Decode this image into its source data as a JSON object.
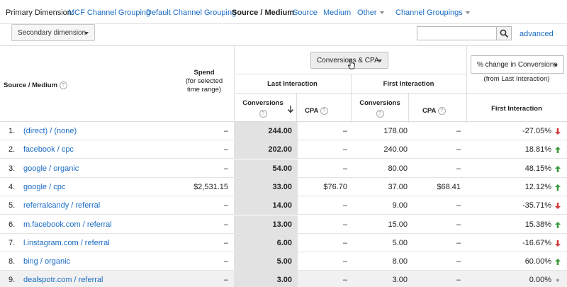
{
  "dimension_bar": {
    "primary_label": "Primary Dimension:",
    "items": [
      {
        "label": "MCF Channel Grouping",
        "active": false
      },
      {
        "label": "Default Channel Grouping",
        "active": false
      },
      {
        "label": "Source / Medium",
        "active": true
      },
      {
        "label": "Source",
        "active": false
      },
      {
        "label": "Medium",
        "active": false
      }
    ],
    "other_label": "Other",
    "channel_groupings_label": "Channel Groupings"
  },
  "toolbar": {
    "secondary_dimension_label": "Secondary dimension",
    "search_value": "",
    "advanced_label": "advanced"
  },
  "header": {
    "source_medium": "Source / Medium",
    "spend_line1": "Spend",
    "spend_line2": "(for selected",
    "spend_line3": "time range)",
    "metric_selector": "Conversions & CPA",
    "last_interaction": "Last Interaction",
    "first_interaction": "First Interaction",
    "conversions": "Conversions",
    "cpa": "CPA",
    "pct_selector": "% change in Conversions",
    "from_last": "(from Last Interaction)",
    "first_interaction_sub": "First Interaction"
  },
  "rows": [
    {
      "index": "1.",
      "source": "(direct) / (none)",
      "spend": "–",
      "last_conv": "244.00",
      "last_cpa": "–",
      "first_conv": "178.00",
      "first_cpa": "–",
      "pct": "-27.05%",
      "trend": "down"
    },
    {
      "index": "2.",
      "source": "facebook / cpc",
      "spend": "–",
      "last_conv": "202.00",
      "last_cpa": "–",
      "first_conv": "240.00",
      "first_cpa": "–",
      "pct": "18.81%",
      "trend": "up"
    },
    {
      "index": "3.",
      "source": "google / organic",
      "spend": "–",
      "last_conv": "54.00",
      "last_cpa": "–",
      "first_conv": "80.00",
      "first_cpa": "–",
      "pct": "48.15%",
      "trend": "up"
    },
    {
      "index": "4.",
      "source": "google / cpc",
      "spend": "$2,531.15",
      "last_conv": "33.00",
      "last_cpa": "$76.70",
      "first_conv": "37.00",
      "first_cpa": "$68.41",
      "pct": "12.12%",
      "trend": "up"
    },
    {
      "index": "5.",
      "source": "referralcandy / referral",
      "spend": "–",
      "last_conv": "14.00",
      "last_cpa": "–",
      "first_conv": "9.00",
      "first_cpa": "–",
      "pct": "-35.71%",
      "trend": "down"
    },
    {
      "index": "6.",
      "source": "m.facebook.com / referral",
      "spend": "–",
      "last_conv": "13.00",
      "last_cpa": "–",
      "first_conv": "15.00",
      "first_cpa": "–",
      "pct": "15.38%",
      "trend": "up"
    },
    {
      "index": "7.",
      "source": "l.instagram.com / referral",
      "spend": "–",
      "last_conv": "6.00",
      "last_cpa": "–",
      "first_conv": "5.00",
      "first_cpa": "–",
      "pct": "-16.67%",
      "trend": "down"
    },
    {
      "index": "8.",
      "source": "bing / organic",
      "spend": "–",
      "last_conv": "5.00",
      "last_cpa": "–",
      "first_conv": "8.00",
      "first_cpa": "–",
      "pct": "60.00%",
      "trend": "up"
    },
    {
      "index": "9.",
      "source": "dealspotr.com / referral",
      "spend": "–",
      "last_conv": "3.00",
      "last_cpa": "–",
      "first_conv": "3.00",
      "first_cpa": "–",
      "pct": "0.00%",
      "trend": "flat"
    }
  ],
  "colors": {
    "link": "#1a6cc4",
    "up": "#3a9a3a",
    "down": "#d23b3b",
    "flat": "#999999"
  }
}
